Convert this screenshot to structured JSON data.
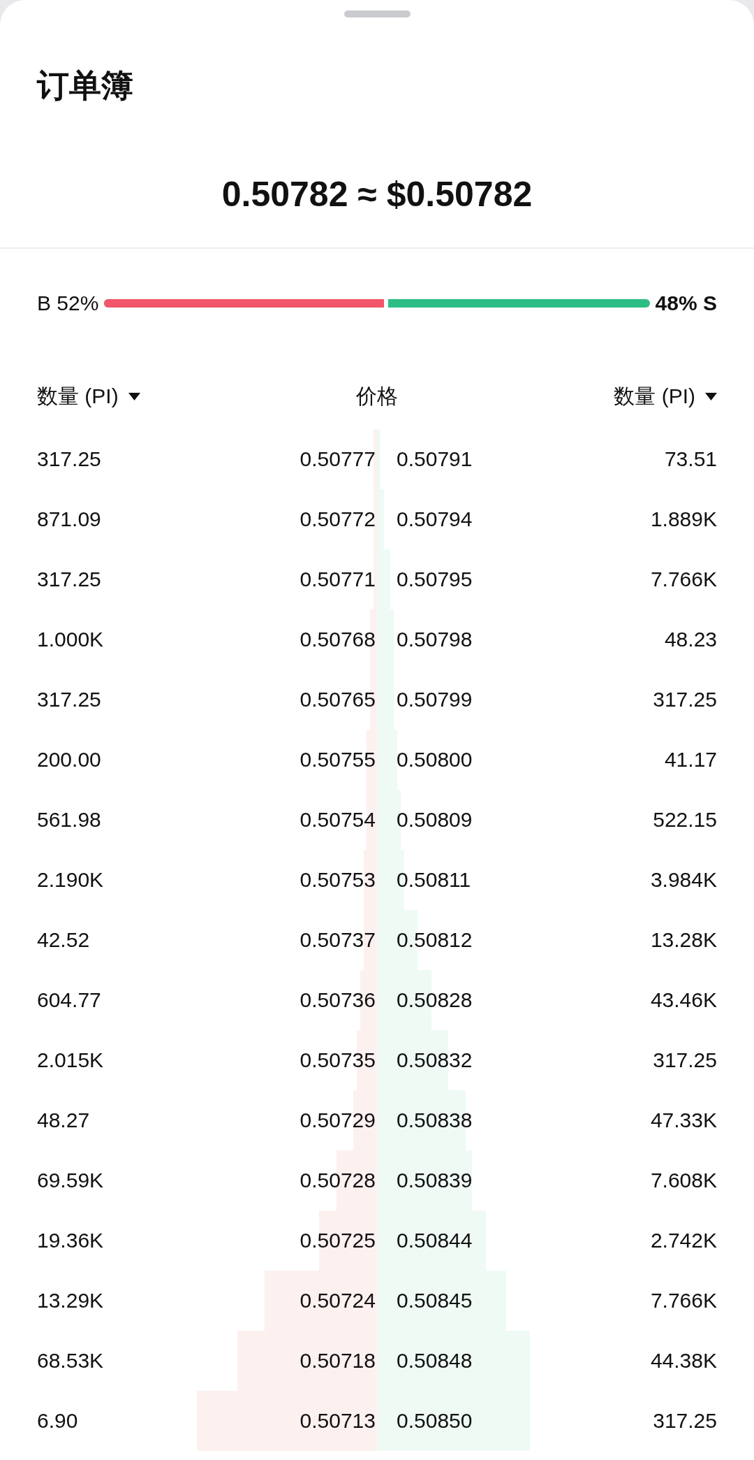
{
  "title": "订单簿",
  "price": "0.50782 ≈ $0.50782",
  "ratio": {
    "buy_label": "B 52%",
    "sell_label": "48% S",
    "level": 0.52
  },
  "columns": [
    {
      "label": "数量 (PI)",
      "kind": "dropdown"
    },
    {
      "label": "价格",
      "kind": "plain"
    },
    {
      "label": "数量 (PI)",
      "kind": "dropdown"
    }
  ],
  "rows": [
    {
      "bid": {
        "qty": "317.25",
        "price": "0.50777",
        "level": 0.01
      },
      "ask": {
        "qty": "73.51",
        "price": "0.50791",
        "level": 0.01
      }
    },
    {
      "bid": {
        "qty": "871.09",
        "price": "0.50772",
        "level": 0.01
      },
      "ask": {
        "qty": "1.889K",
        "price": "0.50794",
        "level": 0.02
      }
    },
    {
      "bid": {
        "qty": "317.25",
        "price": "0.50771",
        "level": 0.01
      },
      "ask": {
        "qty": "7.766K",
        "price": "0.50795",
        "level": 0.04
      }
    },
    {
      "bid": {
        "qty": "1.000K",
        "price": "0.50768",
        "level": 0.02
      },
      "ask": {
        "qty": "48.23",
        "price": "0.50798",
        "level": 0.05
      }
    },
    {
      "bid": {
        "qty": "317.25",
        "price": "0.50765",
        "level": 0.02
      },
      "ask": {
        "qty": "317.25",
        "price": "0.50799",
        "level": 0.05
      }
    },
    {
      "bid": {
        "qty": "200.00",
        "price": "0.50755",
        "level": 0.03
      },
      "ask": {
        "qty": "41.17",
        "price": "0.50800",
        "level": 0.06
      }
    },
    {
      "bid": {
        "qty": "561.98",
        "price": "0.50754",
        "level": 0.03
      },
      "ask": {
        "qty": "522.15",
        "price": "0.50809",
        "level": 0.07
      }
    },
    {
      "bid": {
        "qty": "2.190K",
        "price": "0.50753",
        "level": 0.04
      },
      "ask": {
        "qty": "3.984K",
        "price": "0.50811",
        "level": 0.08
      }
    },
    {
      "bid": {
        "qty": "42.52",
        "price": "0.50737",
        "level": 0.04
      },
      "ask": {
        "qty": "13.28K",
        "price": "0.50812",
        "level": 0.12
      }
    },
    {
      "bid": {
        "qty": "604.77",
        "price": "0.50736",
        "level": 0.05
      },
      "ask": {
        "qty": "43.46K",
        "price": "0.50828",
        "level": 0.16
      }
    },
    {
      "bid": {
        "qty": "2.015K",
        "price": "0.50735",
        "level": 0.06
      },
      "ask": {
        "qty": "317.25",
        "price": "0.50832",
        "level": 0.21
      }
    },
    {
      "bid": {
        "qty": "48.27",
        "price": "0.50729",
        "level": 0.07
      },
      "ask": {
        "qty": "47.33K",
        "price": "0.50838",
        "level": 0.26
      }
    },
    {
      "bid": {
        "qty": "69.59K",
        "price": "0.50728",
        "level": 0.12
      },
      "ask": {
        "qty": "7.608K",
        "price": "0.50839",
        "level": 0.28
      }
    },
    {
      "bid": {
        "qty": "19.36K",
        "price": "0.50725",
        "level": 0.17
      },
      "ask": {
        "qty": "2.742K",
        "price": "0.50844",
        "level": 0.32
      }
    },
    {
      "bid": {
        "qty": "13.29K",
        "price": "0.50724",
        "level": 0.33
      },
      "ask": {
        "qty": "7.766K",
        "price": "0.50845",
        "level": 0.38
      }
    },
    {
      "bid": {
        "qty": "68.53K",
        "price": "0.50718",
        "level": 0.41
      },
      "ask": {
        "qty": "44.38K",
        "price": "0.50848",
        "level": 0.45
      }
    },
    {
      "bid": {
        "qty": "6.90",
        "price": "0.50713",
        "level": 0.53
      },
      "ask": {
        "qty": "317.25",
        "price": "0.50850",
        "level": 0.45
      }
    }
  ]
}
